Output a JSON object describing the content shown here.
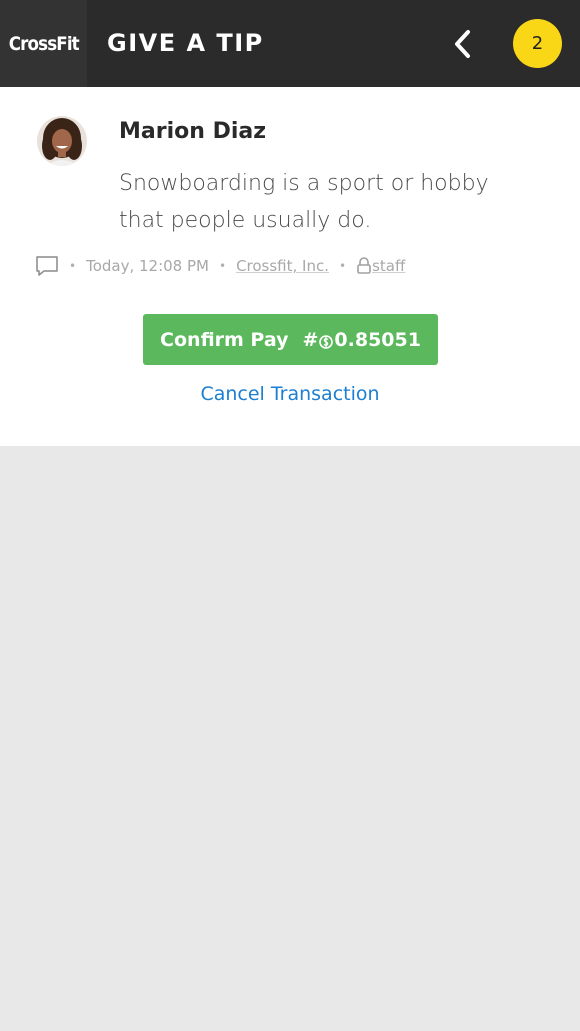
{
  "header": {
    "logo": "CrossFit",
    "title": "GIVE A TIP",
    "back_icon": "chevron-left-icon",
    "badge_count": "2",
    "badge_color": "#f9d616"
  },
  "post": {
    "author": "Marion Diaz",
    "message": "Snowboarding is a sport or hobby that people usually do.",
    "comment_icon": "comment-icon",
    "timestamp": "Today, 12:08 PM",
    "organization": "Crossfit, Inc.",
    "lock_icon": "lock-icon",
    "visibility": "staff"
  },
  "actions": {
    "confirm_label": "Confirm Pay",
    "amount_prefix": "#",
    "currency_icon": "coin-icon",
    "amount": "0.85051",
    "confirm_color": "#5cb85c",
    "cancel_label": "Cancel Transaction",
    "cancel_color": "#1d7fd1"
  }
}
